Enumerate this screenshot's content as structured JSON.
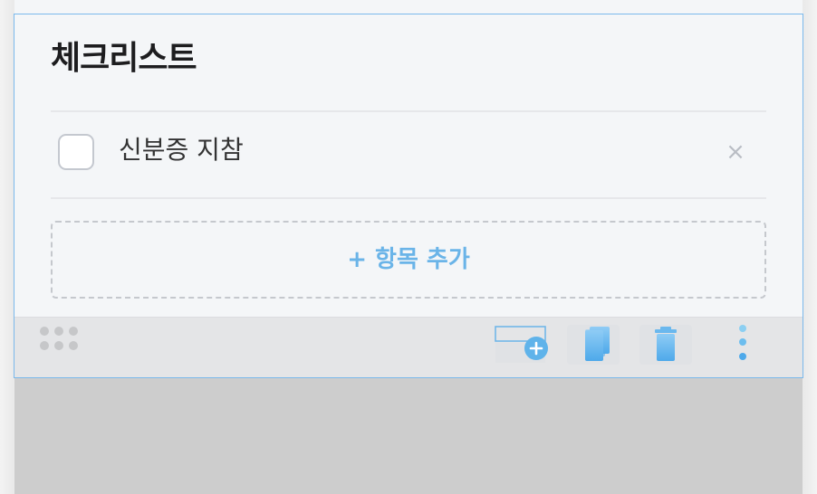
{
  "block": {
    "title": "체크리스트",
    "items": [
      {
        "label": "신분증 지참",
        "checked": false,
        "remove_label": "×"
      }
    ],
    "add_item_label": "+ 항목 추가"
  },
  "toolbar": {
    "icons": [
      "drag-handle-icon",
      "add-block-icon",
      "copy-icon",
      "trash-icon",
      "more-vertical-icon"
    ]
  },
  "colors": {
    "accent": "#6ab4e8",
    "selection_border": "#7ab9ec",
    "block_bg": "#f4f6f8",
    "toolbar_bg": "#e4e5e7",
    "below_area_bg": "#cdcdcd"
  }
}
